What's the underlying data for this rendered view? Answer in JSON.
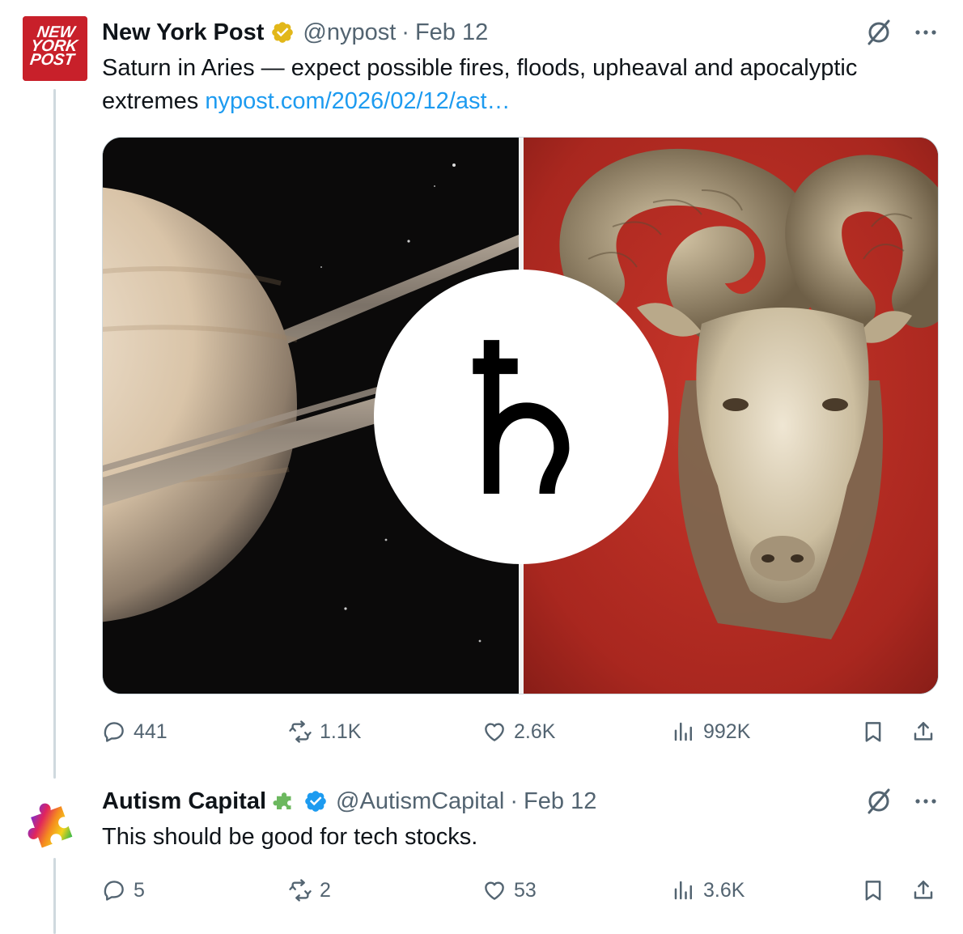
{
  "tweets": [
    {
      "author": {
        "name": "New York Post",
        "handle": "@nypost",
        "verified": "gold-checkmark-badge",
        "avatar_text": [
          "NEW",
          "YORK",
          "POST"
        ]
      },
      "separator": "·",
      "date": "Feb 12",
      "text": "Saturn in Aries — expect possible fires, floods, upheaval and apocalyptic extremes ",
      "link": "nypost.com/2026/02/12/ast…",
      "media": {
        "left": "saturn-planet-image",
        "symbol": "♄",
        "right": "ram-head-sculpture-image"
      },
      "stats": {
        "replies": "441",
        "reposts": "1.1K",
        "likes": "2.6K",
        "views": "992K"
      }
    },
    {
      "author": {
        "name": "Autism Capital",
        "handle": "@AutismCapital",
        "verified": "blue-checkmark-badge",
        "emoji": "puzzle-piece-emoji"
      },
      "separator": "·",
      "date": "Feb 12",
      "text": "This should be good for tech stocks.",
      "stats": {
        "replies": "5",
        "reposts": "2",
        "likes": "53",
        "views": "3.6K"
      }
    }
  ],
  "colors": {
    "text": "#0f1419",
    "secondary": "#536471",
    "link": "#1d9bf0",
    "nypost_red": "#c8202a",
    "gold_badge": "#e2b719",
    "blue_badge": "#1d9bf0"
  }
}
